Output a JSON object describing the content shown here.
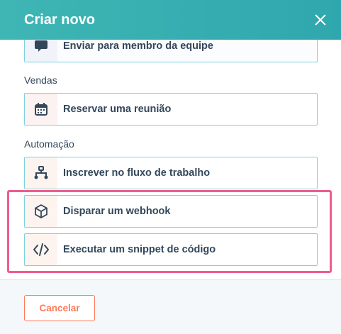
{
  "dialog": {
    "title": "Criar novo",
    "close_icon": "close-icon"
  },
  "options": {
    "send_to_team_member": {
      "label": "Enviar para membro da equipe",
      "icon": "chat-bubble-icon"
    },
    "book_meeting": {
      "label": "Reservar uma reunião",
      "icon": "calendar-icon"
    },
    "enroll_workflow": {
      "label": "Inscrever no fluxo de trabalho",
      "icon": "workflow-icon"
    },
    "trigger_webhook": {
      "label": "Disparar um webhook",
      "icon": "cube-icon"
    },
    "run_code_snippet": {
      "label": "Executar um snippet de código",
      "icon": "code-icon"
    }
  },
  "sections": {
    "sales": "Vendas",
    "automation": "Automação"
  },
  "footer": {
    "cancel_label": "Cancelar"
  },
  "colors": {
    "header": "#3fb6b4",
    "option_border": "#7fd1de",
    "highlight": "#ef5c8c",
    "cancel": "#ff7a59"
  }
}
